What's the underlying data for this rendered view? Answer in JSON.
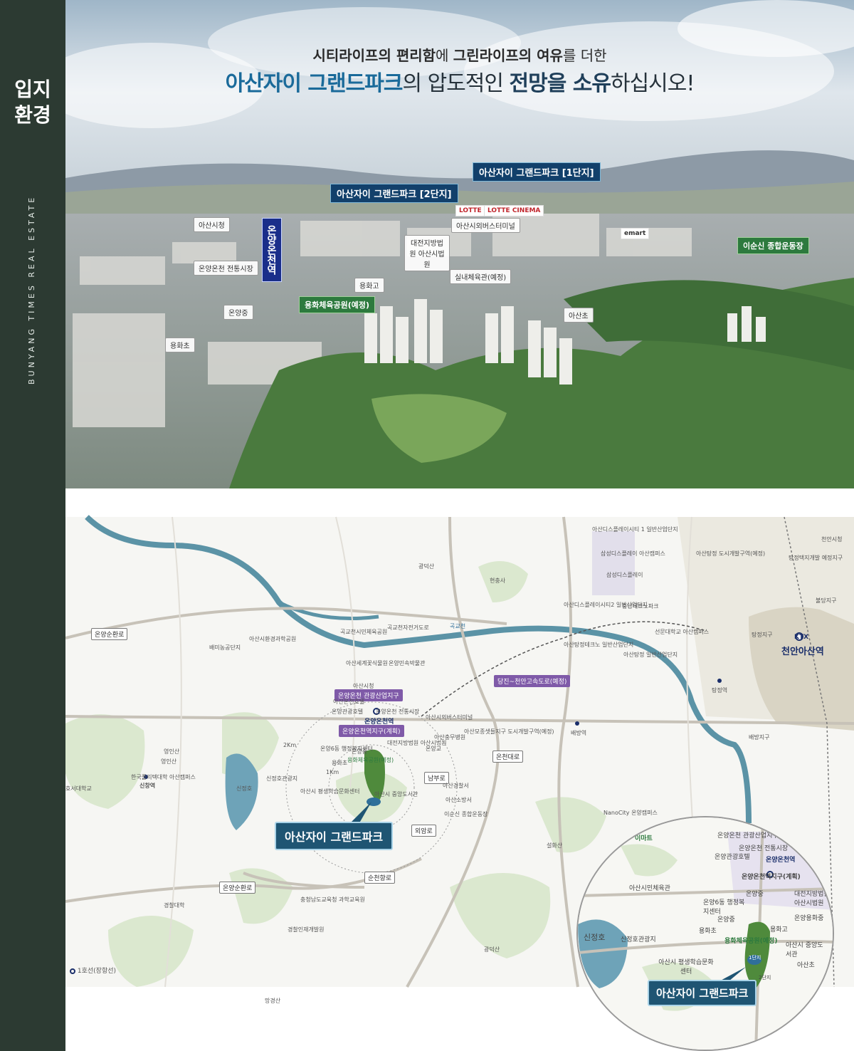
{
  "sidebar": {
    "title_line1": "입지",
    "title_line2": "환경",
    "brand": "BUNYANG TIMES REAL ESTATE"
  },
  "headline": {
    "line1_a": "시티라이프의 편리함",
    "line1_b": "에 ",
    "line1_c": "그린라이프의 여유",
    "line1_d": "를 더한",
    "line2_a": "아산자이 그랜드파크",
    "line2_b": "의 압도적인 ",
    "line2_c": "전망을 소유",
    "line2_d": "하십시오!"
  },
  "aerial_labels": {
    "complex1": "아산자이 그랜드파크 [1단지]",
    "complex2": "아산자이 그랜드파크 [2단지]",
    "station": "온양온천역",
    "city_hall": "아산시청",
    "market": "온양온천 전통시장",
    "onyang_middle": "온양중",
    "yonghwa_elem": "용화초",
    "yonghwa_high": "용화고",
    "yonghwa_park": "용화체육공원(예정)",
    "court": "대전지방법원 아산시법원",
    "indoor_gym": "실내체육관(예정)",
    "bus_terminal": "아산시외버스터미널",
    "emart": "emart",
    "lotte_mart": "LOTTE Mart",
    "lotte_cinema": "LOTTE CINEMA",
    "sports_field": "이순신 종합운동장",
    "asan_elem": "아산초"
  },
  "map_labels": {
    "main": "아산자이 그랜드파크",
    "onyang_station": "온양온천역",
    "cheonan_asan": "천안아산역",
    "tangjeong": "탕정역",
    "baebang": "배방역",
    "sinchang": "신창역",
    "road_onyang_sunhwan": "온양순환로",
    "road_onyang_sunhwan2": "온양순환로",
    "road_oncheon": "온천대로",
    "road_nambu": "남부로",
    "road_oeam": "외암로",
    "road_suncheon": "순천향로",
    "highway_plan": "당진~천안고속도로(예정)",
    "tourism_zone": "온양온천 관광산업지구",
    "station_zone": "온양온천역지구(계획)",
    "yonghwa_park": "용화체육공원(예정)",
    "sinjeongho": "신정호",
    "gokgyo": "곡교천",
    "gwangdeok": "광덕산",
    "seolhwa": "설화산",
    "yeongin": "영인산",
    "samsung": "삼성디스플레이",
    "km1": "1Km",
    "km2": "2Km",
    "legend": "1호선(장항선)",
    "ktx": "KTX",
    "small": [
      "아산디스플레이시티 1 일반산업단지",
      "삼성디스플레이 아산캠퍼스",
      "아산탕정 도시개발구역(예정)",
      "탕정택지개발 예정지구",
      "천안시청",
      "불당지구",
      "아산디스플레이시티2 일반산업단지",
      "충남테크노파크",
      "선문대학교 아산캠퍼스",
      "아산탕정테크노 일반산업단지",
      "아산탕정 일반산업단지",
      "곡교천자전거도로",
      "아산시환경과학공원",
      "배미농공단지",
      "곡교천시민체육공원",
      "아산세계꽃식물원",
      "아산온천호텔",
      "온양민속박물관",
      "아산시청",
      "온양관광호텔",
      "온양온천 전통시장",
      "아산시외버스터미널",
      "아산모종샛들지구 도시개발구역(예정)",
      "대전지방법원 아산시법원",
      "아산충무병원",
      "온양교",
      "온양중",
      "용화초",
      "온양6동 행정복지센터",
      "아산시 평생학습문화센터",
      "아산시 중앙도서관",
      "아산경찰서",
      "아산소방서",
      "이순신 종합운동장",
      "영인산",
      "한국폴리텍대학 아산캠퍼스",
      "호서대학교",
      "신정호관광지",
      "충청남도교육청 과학교육원",
      "경찰대학",
      "경찰인재개발원",
      "탕정지구",
      "배방지구",
      "NanoCity 온양캠퍼스",
      "현충사",
      "광덕산",
      "망경산"
    ]
  },
  "zoom_labels": {
    "tourism_zone": "온양온천 관광산업지구",
    "market": "온양온천 전통시장",
    "hotel": "온양관광호텔",
    "station": "온양온천역",
    "station_zone": "온양온천역지구(계획)",
    "gym": "아산시민체육관",
    "onyang_middle_school": "온양중",
    "court": "대전지방법원 아산시법원",
    "onyang6": "온양6동 행정복지센터",
    "onyang_middle": "온양중",
    "onyang_middle2": "온양용화중",
    "yonghwa_high": "용화고",
    "yonghwa_elem": "용화초",
    "park": "용화체육공원(예정)",
    "sinjeongho": "신정호",
    "sinjeongho_park": "신정호관광지",
    "library": "아산시 중앙도서관",
    "lifelong": "아산시 평생학습문화센터",
    "asan_elem": "아산초",
    "complex1": "1단지",
    "complex2": "2단지",
    "homeplus": "이마트",
    "callout": "아산자이 그랜드파크"
  },
  "colors": {
    "sidebar": "#2c3a32",
    "callout": "#1f5573",
    "river": "#5b93a6",
    "purple": "#7f5aa8"
  }
}
